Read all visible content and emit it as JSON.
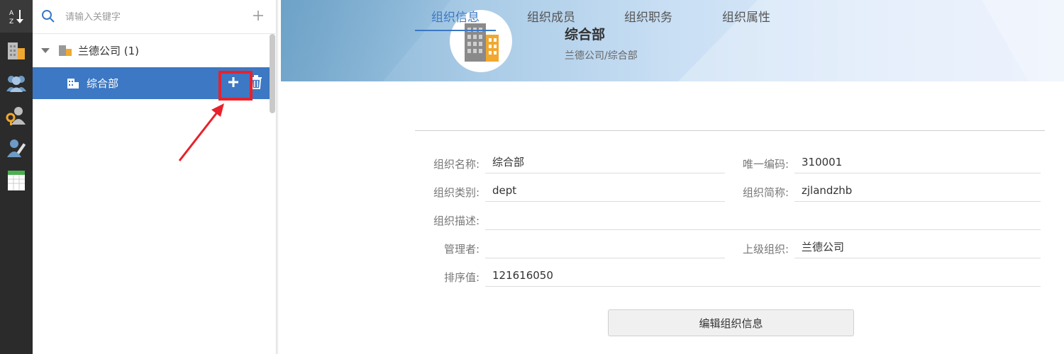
{
  "rail": {
    "items": [
      {
        "icon": "sort-az-icon"
      },
      {
        "icon": "building-icon"
      },
      {
        "icon": "users-icon"
      },
      {
        "icon": "role-key-icon"
      },
      {
        "icon": "user-edit-icon"
      },
      {
        "icon": "spreadsheet-icon"
      }
    ]
  },
  "tree": {
    "search_placeholder": "请输入关键字",
    "root_label": "兰德公司 (1)",
    "child_label": "综合部",
    "colors": {
      "selected": "#3c78c3",
      "highlight": "#e8212b"
    }
  },
  "header": {
    "title": "综合部",
    "path": "兰德公司/综合部"
  },
  "tabs": [
    "组织信息",
    "组织成员",
    "组织职务",
    "组织属性"
  ],
  "form": {
    "org_name_label": "组织名称:",
    "org_name_value": "综合部",
    "unique_code_label": "唯一编码:",
    "unique_code_value": "310001",
    "org_type_label": "组织类别:",
    "org_type_value": "dept",
    "short_name_label": "组织简称:",
    "short_name_value": "zjlandzhb",
    "description_label": "组织描述:",
    "description_value": "",
    "manager_label": "管理者:",
    "manager_value": "",
    "parent_org_label": "上级组织:",
    "parent_org_value": "兰德公司",
    "sort_value_label": "排序值:",
    "sort_value_value": "121616050"
  },
  "edit_button_label": "编辑组织信息"
}
